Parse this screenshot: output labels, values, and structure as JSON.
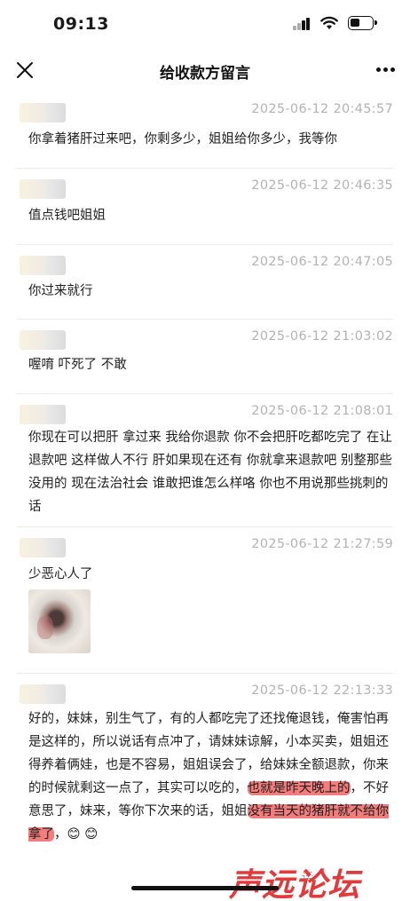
{
  "status_bar": {
    "time": "09:13"
  },
  "nav": {
    "title": "给收款方留言"
  },
  "messages": [
    {
      "time": "2025-06-12 20:45:57",
      "text": "你拿着猪肝过来吧，你剩多少，姐姐给你多少，我等你"
    },
    {
      "time": "2025-06-12 20:46:35",
      "text": "值点钱吧姐姐"
    },
    {
      "time": "2025-06-12 20:47:05",
      "text": "你过来就行"
    },
    {
      "time": "2025-06-12 21:03:02",
      "text": "喔唷 吓死了 不敢"
    },
    {
      "time": "2025-06-12 21:08:01",
      "text": "你现在可以把肝 拿过来 我给你退款 你不会把肝吃都吃完了 在让退款吧 这样做人不行 肝如果现在还有 你就拿来退款吧 别整那些没用的 现在法治社会 谁敢把谁怎么样咯 你也不用说那些挑刺的话"
    },
    {
      "time": "2025-06-12 21:27:59",
      "text": "少恶心人了"
    },
    {
      "time": "2025-06-12 22:13:33",
      "text_parts": [
        "好的，妹妹，别生气了，有的人都吃完了还找俺退钱，俺害怕再是这样的，所以说话有点冲了，请妹妹谅解，小本买卖，姐姐还得养着俩娃，也是不容易，姐姐误会了，给妹妹全额退款，你来的时候就剩这一点了，其实可以吃的，",
        "也就是昨天晚上的",
        "，不好意思了，妹来，等你下次来的话，姐姐",
        "没有当天的猪肝就不给你拿了",
        "，😊 😊"
      ]
    }
  ],
  "watermark": {
    "logo": "声远论坛",
    "faint": "话"
  },
  "colors": {
    "highlight": "#f05c5c",
    "timestamp": "#b3b3b3",
    "watermark": "#e23a3a"
  }
}
